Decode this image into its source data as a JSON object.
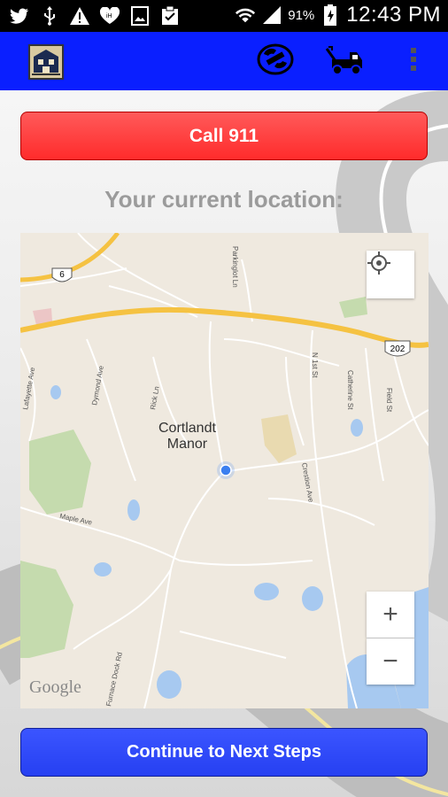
{
  "status_bar": {
    "battery_percent": "91%",
    "time": "12:43 PM",
    "icons": [
      "twitter-icon",
      "usb-icon",
      "warning-icon",
      "iheart-icon",
      "image-icon",
      "clipboard-icon",
      "wifi-icon",
      "signal-icon",
      "battery-icon"
    ]
  },
  "app_bar": {
    "logo_icon": "app-logo-icon",
    "actions": [
      "phone-icon",
      "tow-truck-icon",
      "overflow-menu-icon"
    ],
    "color": "#0a1fff"
  },
  "main": {
    "call_button": "Call 911",
    "location_label": "Your current location:",
    "continue_button": "Continue to Next Steps"
  },
  "map": {
    "town_line1": "Cortlandt",
    "town_line2": "Manor",
    "attribution": "Google",
    "route_6": "6",
    "route_202": "202",
    "streets": {
      "parkinglot": "Parkinglot Ln",
      "n1st": "N 1st St",
      "catherine": "Catherine St",
      "field": "Field St",
      "lafayette": "Lafayette Ave",
      "dymond": "Dymond Ave",
      "rick": "Rick Ln",
      "crestion": "Crestion Ave",
      "maple": "Maple Ave",
      "furnace": "Furnace Dock Rd"
    },
    "zoom_in": "+",
    "zoom_out": "−"
  }
}
